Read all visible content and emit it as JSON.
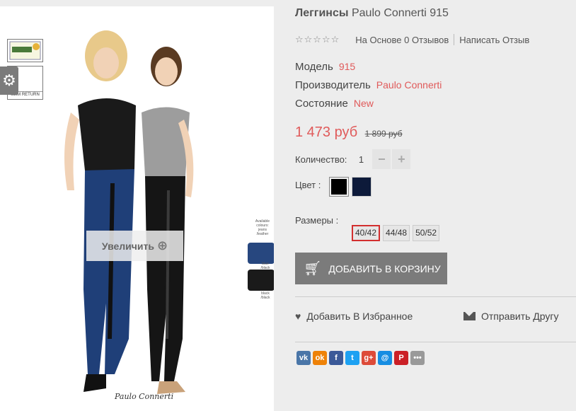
{
  "gallery": {
    "zoom_label": "Увеличить",
    "badge_slim": "SLIM RETURN",
    "signature": "Paulo Connerti",
    "side_labels": [
      "Available colours: jeans /leather",
      "blue /black",
      "black /black"
    ]
  },
  "product": {
    "category": "Леггинсы",
    "name": "Paulo Connerti 915",
    "rating": {
      "stars": 0,
      "max": 5,
      "reviews_text": "На Основе 0 Отзывов",
      "write_review": "Написать Отзыв"
    },
    "model_label": "Модель",
    "model_value": "915",
    "maker_label": "Производитель",
    "maker_value": "Paulo Connerti",
    "state_label": "Состояние",
    "state_value": "New",
    "price_new": "1 473 руб",
    "price_old": "1 899 руб",
    "qty_label": "Количество:",
    "qty_value": "1",
    "qty_minus": "−",
    "qty_plus": "+",
    "color_label": "Цвет :",
    "colors": [
      {
        "name": "black",
        "hex": "#000000",
        "selected": true
      },
      {
        "name": "navy",
        "hex": "#0d1a3a",
        "selected": false
      }
    ],
    "sizes_label": "Размеры :",
    "sizes": [
      {
        "label": "40/42",
        "active": true
      },
      {
        "label": "44/48",
        "active": false
      },
      {
        "label": "50/52",
        "active": false
      }
    ],
    "cart_label": "ДОБАВИТЬ В КОРЗИНУ",
    "wishlist_label": "Добавить В Избранное",
    "send_label": "Отправить Другу"
  },
  "share": [
    {
      "icon": "vk-icon",
      "glyph": "vk",
      "color": "#4a76a8"
    },
    {
      "icon": "odnoklassniki-icon",
      "glyph": "ok",
      "color": "#ee8208"
    },
    {
      "icon": "facebook-icon",
      "glyph": "f",
      "color": "#3b5998"
    },
    {
      "icon": "twitter-icon",
      "glyph": "t",
      "color": "#1da1f2"
    },
    {
      "icon": "google-plus-icon",
      "glyph": "g+",
      "color": "#dd4b39"
    },
    {
      "icon": "mail-ru-icon",
      "glyph": "@",
      "color": "#168de2"
    },
    {
      "icon": "pinterest-icon",
      "glyph": "P",
      "color": "#cb2027"
    },
    {
      "icon": "more-icon",
      "glyph": "•••",
      "color": "#999999"
    }
  ],
  "colors": {
    "accent": "#e05a5a",
    "button": "#7b7b7b",
    "active_size_border": "#d32f2f"
  }
}
